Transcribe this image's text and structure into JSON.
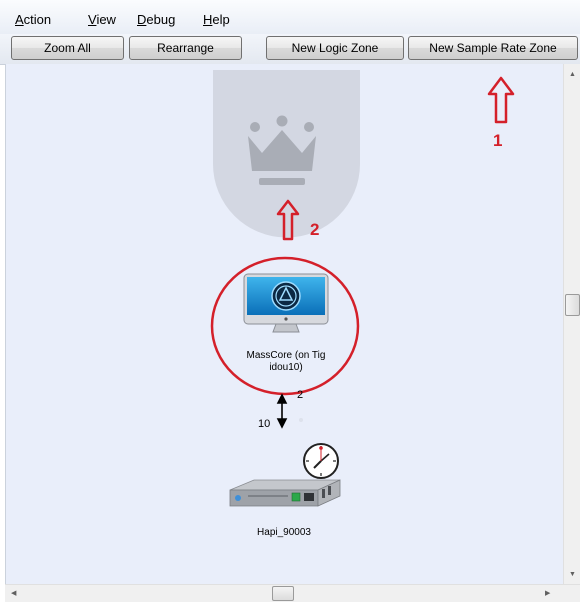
{
  "menu": {
    "action": {
      "first": "A",
      "rest": "ction"
    },
    "view": {
      "first": "V",
      "rest": "iew"
    },
    "debug": {
      "first": "D",
      "rest": "ebug"
    },
    "help": {
      "first": "H",
      "rest": "elp"
    }
  },
  "toolbar": {
    "zoom_all": "Zoom All",
    "rearrange": "Rearrange",
    "new_logic_zone": "New Logic Zone",
    "new_sample_rate_zone": "New Sample Rate Zone"
  },
  "nodes": {
    "masscore": {
      "label_line1": "MassCore (on Tig",
      "label_line2": "idou10)"
    },
    "hapi": {
      "label": "Hapi_90003"
    }
  },
  "connection": {
    "up_count": "2",
    "down_count": "10"
  },
  "annotations": {
    "marker_1": "1",
    "marker_2": "2"
  },
  "colors": {
    "annotation": "#d4202a",
    "canvas_bg": "#e9eefa",
    "zone_bg": "#d3d7e2",
    "crown": "#a9adb6"
  }
}
